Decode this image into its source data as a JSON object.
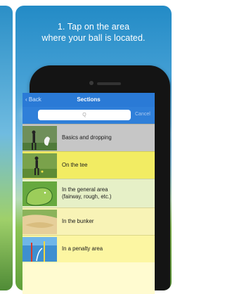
{
  "headline": {
    "line1": "1. Tap on the area",
    "line2": "where your ball is located."
  },
  "nav": {
    "back_label": "Back",
    "title": "Sections"
  },
  "search": {
    "placeholder": "Q",
    "cancel_label": "Cancel"
  },
  "sections": [
    {
      "label": "Basics and dropping",
      "icon": "golfer-dropping-icon"
    },
    {
      "label": "On the tee",
      "icon": "tee-icon"
    },
    {
      "label_line1": "In the general area",
      "label_line2": "(fairway, rough, etc.)",
      "icon": "fairway-icon"
    },
    {
      "label": "In the bunker",
      "icon": "bunker-icon"
    },
    {
      "label": "In a penalty area",
      "icon": "penalty-area-icon"
    }
  ]
}
